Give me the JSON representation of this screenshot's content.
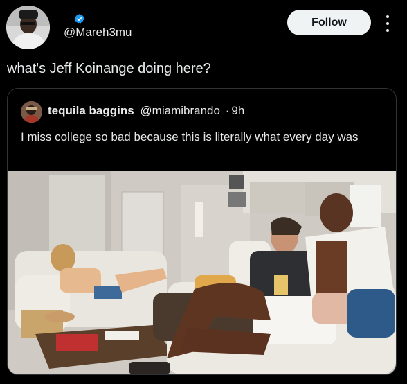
{
  "author": {
    "handle": "@Mareh3mu",
    "verified": true,
    "verified_color": "#1d9bf0"
  },
  "follow_label": "Follow",
  "tweet_text": "what's Jeff Koinange doing here?",
  "quoted_tweet": {
    "name": "tequila baggins",
    "handle": "@miamibrando",
    "separator": "·",
    "time": "9h",
    "text": "I miss college so bad because this is literally what every day was"
  },
  "icons": {
    "verified": "verified-badge-icon",
    "more": "more-options-icon"
  },
  "colors": {
    "background": "#000000",
    "text": "#e7e9ea",
    "follow_bg": "#eff3f4",
    "border": "#2f3336"
  }
}
